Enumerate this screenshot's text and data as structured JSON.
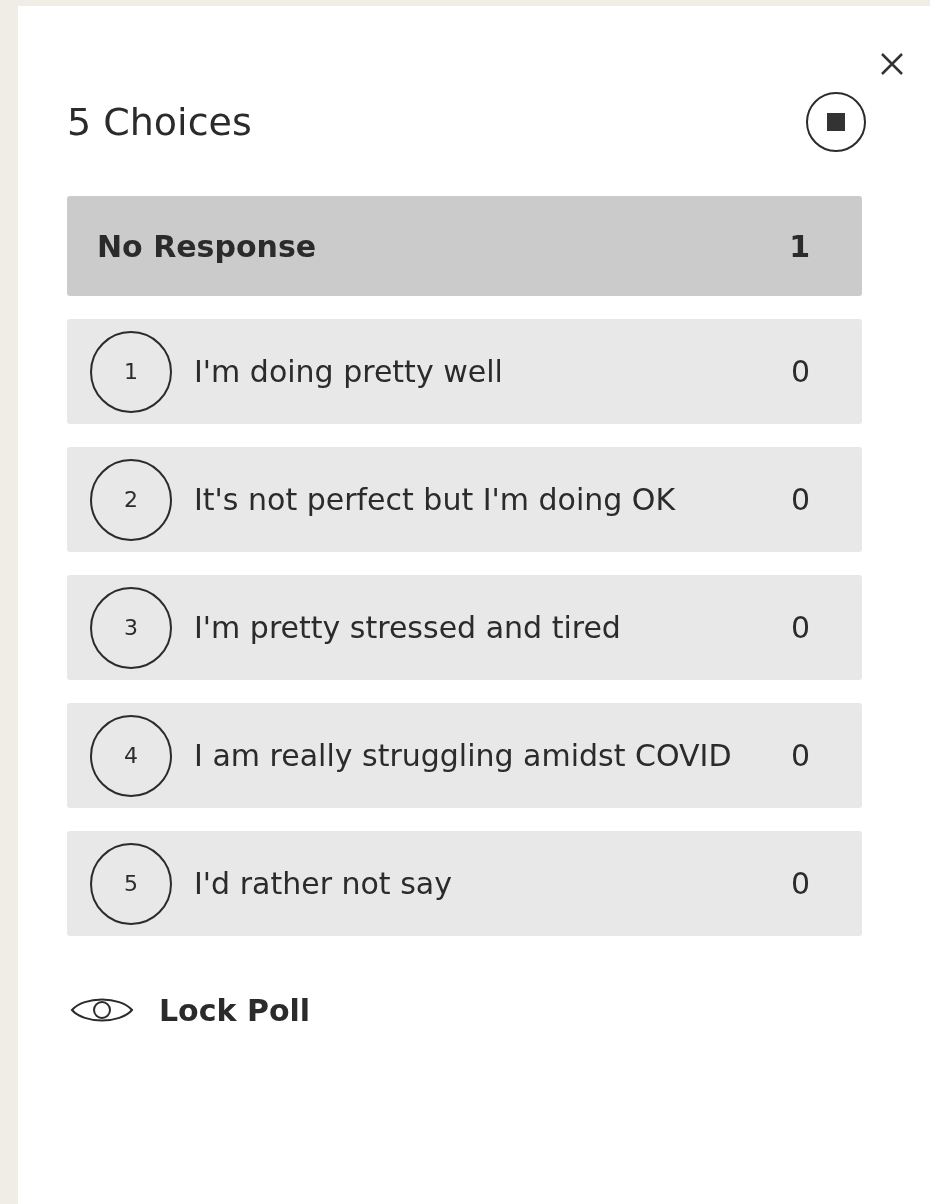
{
  "title": "5 Choices",
  "no_response": {
    "label": "No Response",
    "count": "1"
  },
  "choices": [
    {
      "number": "1",
      "label": "I'm doing pretty well",
      "count": "0"
    },
    {
      "number": "2",
      "label": "It's not perfect but I'm doing OK",
      "count": "0"
    },
    {
      "number": "3",
      "label": "I'm pretty stressed and tired",
      "count": "0"
    },
    {
      "number": "4",
      "label": "I am really struggling amidst COVID",
      "count": "0"
    },
    {
      "number": "5",
      "label": "I'd rather not say",
      "count": "0"
    }
  ],
  "lock_poll": {
    "label": "Lock Poll"
  }
}
